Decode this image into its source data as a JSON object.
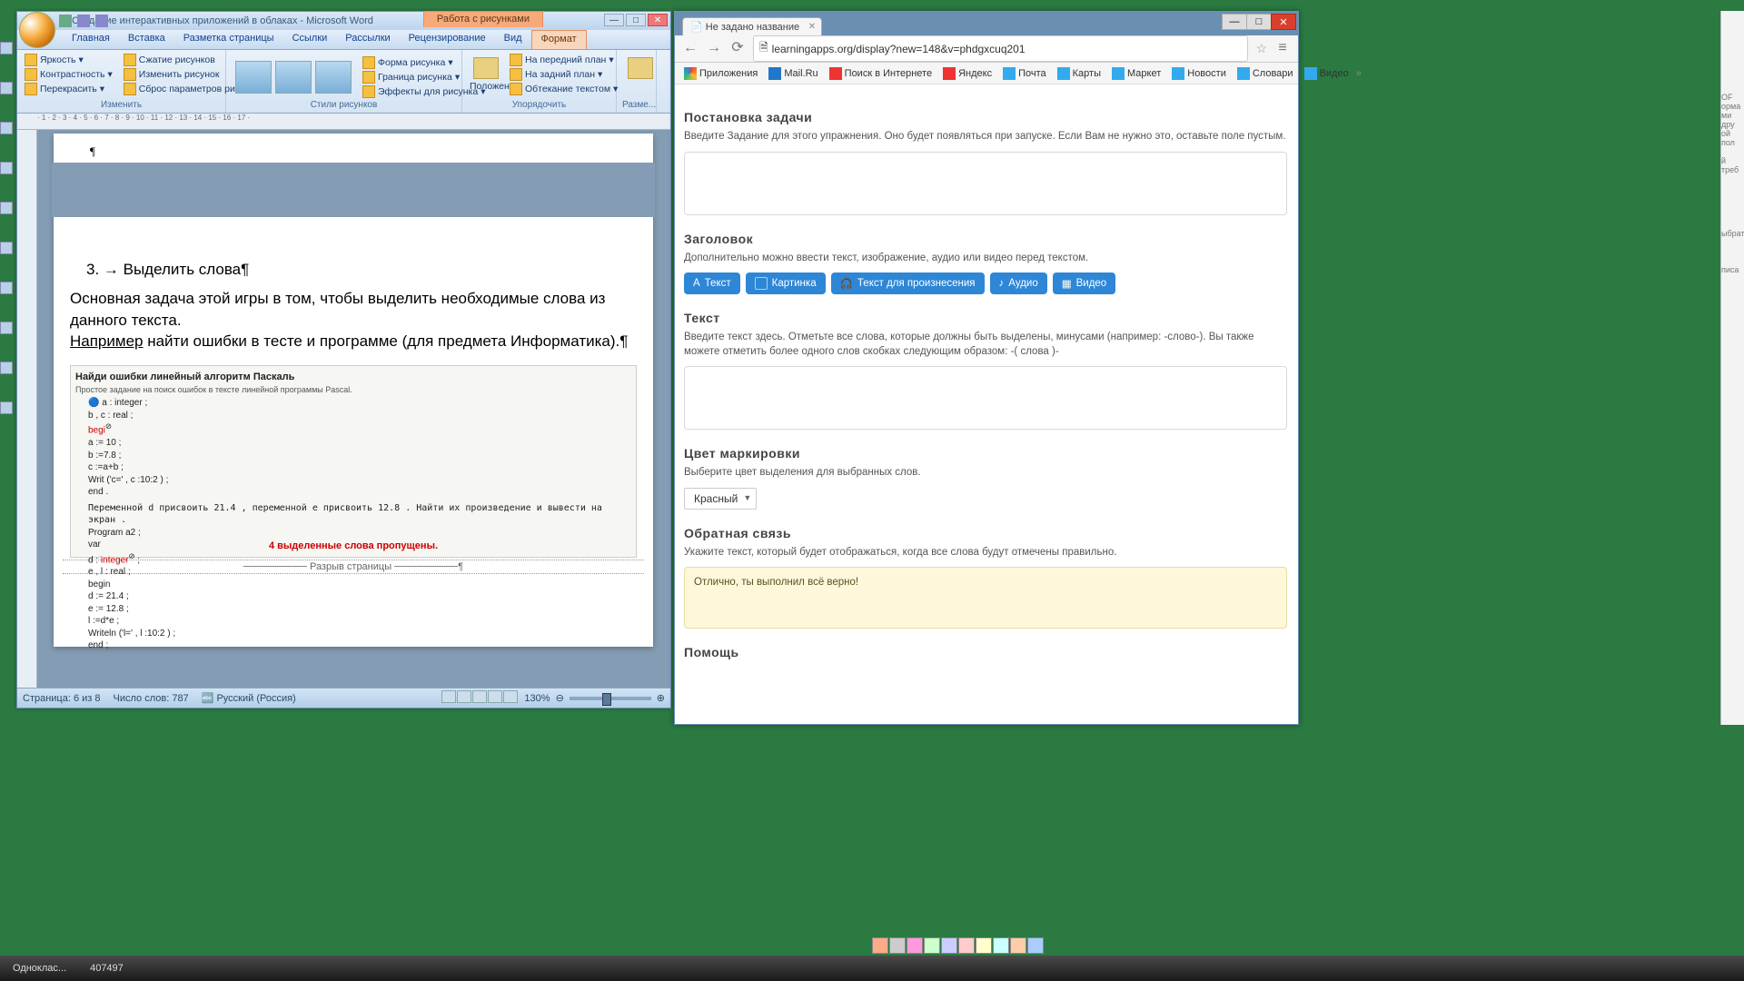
{
  "word": {
    "title": "Создание интерактивных приложений в облаках - Microsoft Word",
    "contextual_tab_group": "Работа с рисунками",
    "tabs": [
      "Главная",
      "Вставка",
      "Разметка страницы",
      "Ссылки",
      "Рассылки",
      "Рецензирование",
      "Вид",
      "Формат"
    ],
    "active_tab": 7,
    "ribbon": {
      "group1": {
        "label": "Изменить",
        "btns": [
          "Яркость",
          "Контрастность",
          "Перекрасить",
          "Сжатие рисунков",
          "Изменить рисунок",
          "Сброс параметров рисунка"
        ]
      },
      "group2": {
        "label": "Стили рисунков",
        "btns": [
          "Форма рисунка",
          "Граница рисунка",
          "Эффекты для рисунка"
        ]
      },
      "group3": {
        "label": "Упорядочить",
        "pos": "Положение",
        "btns": [
          "На передний план",
          "На задний план",
          "Обтекание текстом"
        ]
      },
      "group4": {
        "label": "Размер",
        "btns": [
          "Разме..."
        ]
      }
    },
    "doc": {
      "heading": "3. → Выделить слова¶",
      "p1": "Основная задача этой игры в том, чтобы выделить необходимые слова из данного текста. ",
      "p2_u": "Например",
      "p2_rest": " найти ошибки в тесте и программе (для предмета Информатика).¶",
      "embed": {
        "title": "Найди ошибки линейный алгоритм Паскаль",
        "subtitle": "Простое задание на поиск ошибок в тексте линейной программы Pascal.",
        "code1": [
          "a : integer ;",
          "b , c : real ;",
          "begi",
          "a := 10 ;",
          "b :=7.8 ;",
          "c :=a+b ;",
          "Writ ('c=', c :10:2 ) ;",
          "end ."
        ],
        "code2_intro": "Переменной d присвоить 21.4 , переменной e присвоить 12.8 . Найти их произведение и вывести на экран .",
        "code2": [
          "Program a2 ;",
          "var",
          "d : integer ;",
          "e , l : real ;",
          "begin",
          "d := 21.4 ;",
          "e := 12.8 ;",
          "l :=d*e ;",
          "Writeln ('l=', l :10:2 ) ;",
          "end ;"
        ],
        "footer": "4 выделенные слова пропущены."
      },
      "page_break": "Разрыв страницы"
    },
    "status": {
      "page": "Страница: 6 из 8",
      "words": "Число слов: 787",
      "lang": "Русский (Россия)",
      "zoom": "130%"
    }
  },
  "chrome": {
    "tab_title": "Не задано название",
    "url": "learningapps.org/display?new=148&v=phdgxcuq201",
    "bookmarks": [
      "Приложения",
      "Mail.Ru",
      "Поиск в Интернете",
      "Яндекс",
      "Почта",
      "Карты",
      "Маркет",
      "Новости",
      "Словари",
      "Видео"
    ],
    "sections": {
      "task": {
        "title": "Постановка задачи",
        "desc": "Введите Задание для этого упражнения. Оно будет появляться при запуске. Если Вам не нужно это, оставьте поле пустым."
      },
      "header": {
        "title": "Заголовок",
        "desc": "Дополнительно можно ввести текст, изображение, аудио или видео перед текстом."
      },
      "pills": [
        "Текст",
        "Картинка",
        "Текст для произнесения",
        "Аудио",
        "Видео"
      ],
      "text": {
        "title": "Текст",
        "desc": "Введите текст здесь. Отметьте все слова, которые должны быть выделены, минусами (например: -слово-). Вы также можете отметить более одного слов скобках следующим образом: -( слова )-"
      },
      "color": {
        "title": "Цвет маркировки",
        "desc": "Выберите цвет выделения для выбранных слов.",
        "value": "Красный"
      },
      "feedback": {
        "title": "Обратная связь",
        "desc": "Укажите текст, который будет отображаться, когда все слова будут отмечены правильно.",
        "value": "Отлично, ты выполнил всё верно!"
      },
      "help": {
        "title": "Помощь"
      }
    }
  },
  "taskbar": {
    "item1": "Одноклас...",
    "item2": "407497"
  }
}
